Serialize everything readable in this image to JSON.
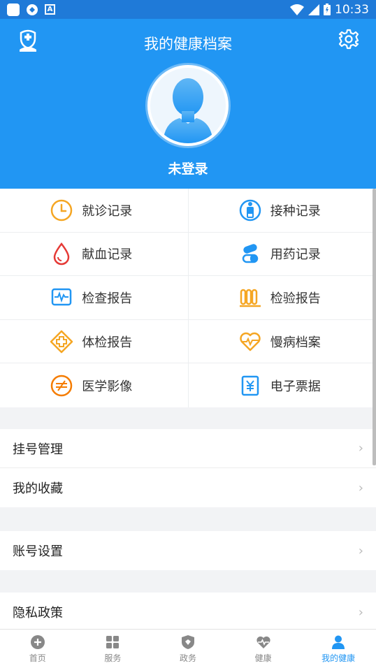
{
  "status_bar": {
    "time": "10:33",
    "icons": [
      "notification-icon",
      "app-icon",
      "a-icon",
      "wifi-icon",
      "signal-icon",
      "battery-icon"
    ]
  },
  "header": {
    "title": "我的健康档案",
    "login_status": "未登录",
    "logo_icon": "nurse-logo-icon",
    "settings_icon": "gear-icon"
  },
  "records": [
    {
      "label": "就诊记录",
      "icon": "clock-icon",
      "color": "#f5a623"
    },
    {
      "label": "接种记录",
      "icon": "vaccine-icon",
      "color": "#2196f3"
    },
    {
      "label": "献血记录",
      "icon": "blood-drop-icon",
      "color": "#e53935"
    },
    {
      "label": "用药记录",
      "icon": "pill-icon",
      "color": "#2196f3"
    },
    {
      "label": "检查报告",
      "icon": "monitor-icon",
      "color": "#2196f3"
    },
    {
      "label": "检验报告",
      "icon": "test-tubes-icon",
      "color": "#f5a623"
    },
    {
      "label": "体检报告",
      "icon": "cross-diamond-icon",
      "color": "#f5a623"
    },
    {
      "label": "慢病档案",
      "icon": "heart-pulse-icon",
      "color": "#f5a623"
    },
    {
      "label": "医学影像",
      "icon": "imaging-icon",
      "color": "#f57c00"
    },
    {
      "label": "电子票据",
      "icon": "receipt-icon",
      "color": "#2196f3"
    }
  ],
  "menu_groups": [
    {
      "items": [
        {
          "label": "挂号管理"
        },
        {
          "label": "我的收藏"
        }
      ]
    },
    {
      "items": [
        {
          "label": "账号设置"
        }
      ]
    },
    {
      "items": [
        {
          "label": "隐私政策"
        }
      ]
    }
  ],
  "tabs": [
    {
      "label": "首页",
      "icon": "home-plus-icon",
      "active": false
    },
    {
      "label": "服务",
      "icon": "grid-icon",
      "active": false
    },
    {
      "label": "政务",
      "icon": "shield-icon",
      "active": false
    },
    {
      "label": "健康",
      "icon": "heart-icon",
      "active": false
    },
    {
      "label": "我的健康",
      "icon": "person-icon",
      "active": true
    }
  ],
  "colors": {
    "primary": "#2196f3",
    "status_bar": "#1f7ad8",
    "background": "#f2f3f5"
  }
}
